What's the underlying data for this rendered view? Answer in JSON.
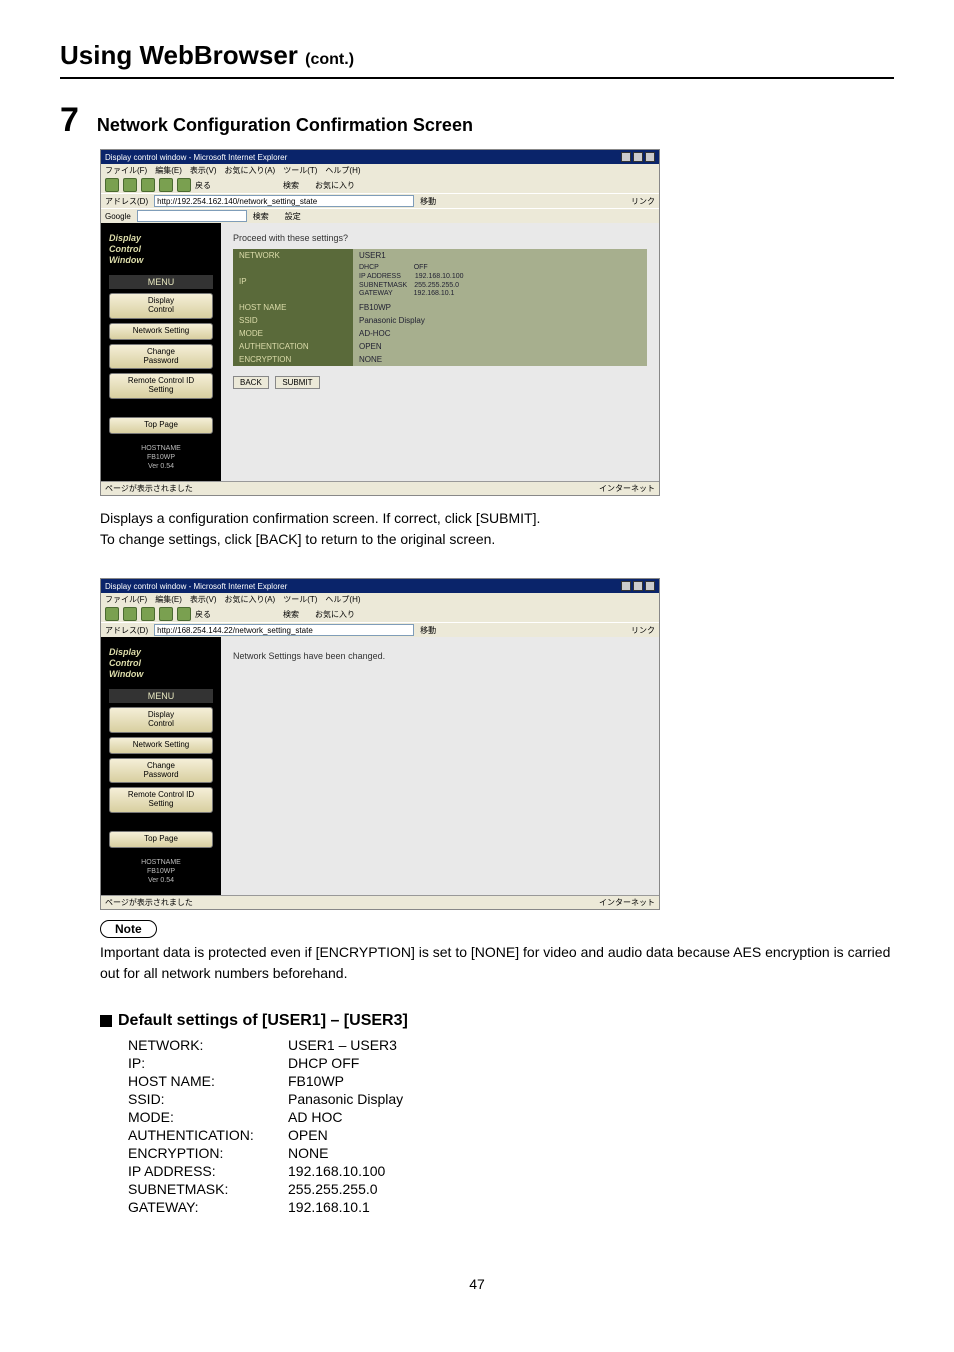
{
  "header": {
    "title": "Using WebBrowser",
    "cont": "(cont.)"
  },
  "step": {
    "number": "7",
    "title": "Network Configuration Confirmation Screen"
  },
  "browser_common": {
    "window_title": "Display control window - Microsoft Internet Explorer",
    "menubar": "ファイル(F)　編集(E)　表示(V)　お気に入り(A)　ツール(T)　ヘルプ(H)",
    "toolbar_text": "戻る　　　　　　　　　検索　　お気に入り",
    "addr_label": "アドレス(D)",
    "go_label": "移動",
    "links_label": "リンク",
    "google_label": "Google",
    "google_btns": "検索　　設定",
    "status_left": "ページが表示されました",
    "status_right": "インターネット"
  },
  "shot1": {
    "url": "http://192.254.162.140/network_setting_state",
    "logo1": "Display",
    "logo2": "Control",
    "logo3": "Window",
    "menu_head": "MENU",
    "side": [
      "Display\nControl",
      "Network Setting",
      "Change\nPassword",
      "Remote Control ID\nSetting",
      "Top Page"
    ],
    "host_info": "HOSTNAME\nFB10WP\nVer 0.54",
    "proceed": "Proceed with these settings?",
    "rows": [
      {
        "k": "NETWORK",
        "v": "USER1"
      },
      {
        "k": "IP",
        "v_html": "DHCP　　　　　OFF\nIP ADDRESS　　192.168.10.100\nSUBNETMASK　255.255.255.0\nGATEWAY　　　192.168.10.1"
      },
      {
        "k": "HOST NAME",
        "v": "FB10WP"
      },
      {
        "k": "SSID",
        "v": "Panasonic Display"
      },
      {
        "k": "MODE",
        "v": "AD-HOC"
      },
      {
        "k": "AUTHENTICATION",
        "v": "OPEN"
      },
      {
        "k": "ENCRYPTION",
        "v": "NONE"
      }
    ],
    "back": "BACK",
    "submit": "SUBMIT"
  },
  "para1": "Displays a configuration confirmation screen. If correct, click [SUBMIT].",
  "para2": "To change settings, click [BACK] to return to the original screen.",
  "shot2": {
    "url": "http://168.254.144.22/network_setting_state",
    "changed": "Network Settings have been changed."
  },
  "note": {
    "label": "Note",
    "text": "Important data is protected even if [ENCRYPTION] is set to [NONE] for video and audio data because AES encryption is carried out for all network numbers beforehand."
  },
  "defaults": {
    "heading": "Default settings of [USER1] – [USER3]",
    "rows": [
      [
        "NETWORK:",
        "USER1 – USER3"
      ],
      [
        "IP:",
        "DHCP OFF"
      ],
      [
        "HOST NAME:",
        "FB10WP"
      ],
      [
        "SSID:",
        "Panasonic Display"
      ],
      [
        "MODE:",
        "AD HOC"
      ],
      [
        "AUTHENTICATION:",
        "OPEN"
      ],
      [
        "ENCRYPTION:",
        "NONE"
      ],
      [
        "IP ADDRESS:",
        "192.168.10.100"
      ],
      [
        "SUBNETMASK:",
        "255.255.255.0"
      ],
      [
        "GATEWAY:",
        "192.168.10.1"
      ]
    ]
  },
  "page_no": "47"
}
